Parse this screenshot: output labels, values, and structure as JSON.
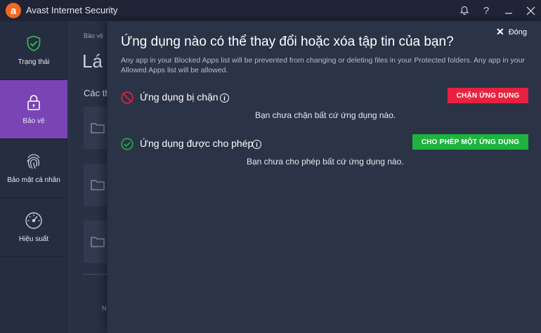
{
  "app": {
    "title": "Avast Internet Security",
    "logo_letter": "a",
    "brand_color": "#f26722"
  },
  "titlebar": {
    "icons": [
      "bell-icon",
      "help-icon",
      "minimize-icon",
      "close-icon"
    ],
    "help_glyph": "?"
  },
  "sidebar": {
    "items": [
      {
        "label": "Trạng thái",
        "icon": "shield-check-icon"
      },
      {
        "label": "Bảo vệ",
        "icon": "lock-icon",
        "active": true
      },
      {
        "label": "Bảo mật cá nhân",
        "icon": "fingerprint-icon"
      },
      {
        "label": "Hiệu suất",
        "icon": "speedometer-icon"
      }
    ],
    "active_color": "#7a43b6"
  },
  "background_page": {
    "breadcrumb": "Bảo vệ",
    "heading": "Lá c",
    "subheading": "Các th",
    "footer_text": "N"
  },
  "panel": {
    "close_label": "Đóng",
    "title": "Ứng dụng nào có thể thay đổi hoặc xóa tập tin của bạn?",
    "description": "Any app in your Blocked Apps list will be prevented from changing or deleting files in your Protected folders. Any app in your Allowed Apps list will be allowed.",
    "blocked": {
      "label": "Ứng dụng bị chặn",
      "button": "CHẶN ỨNG DỤNG",
      "empty_message": "Bạn chưa chặn bất cứ ứng dụng nào.",
      "color": "#e8213f"
    },
    "allowed": {
      "label": "Ứng dụng được cho phép",
      "button": "CHO PHÉP MỘT ỨNG DỤNG",
      "empty_message": "Bạn chưa cho phép bất cứ ứng dụng nào.",
      "color": "#1eb33f"
    },
    "info_glyph": "i"
  }
}
